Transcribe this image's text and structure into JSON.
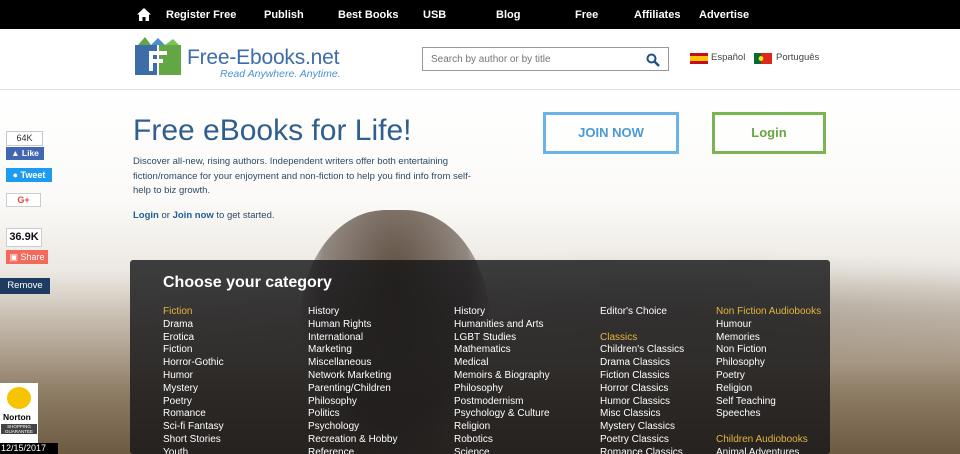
{
  "topnav": {
    "items": [
      "Register Free",
      "Publish",
      "Best Books",
      "USB",
      "Blog",
      "Free",
      "Affiliates",
      "Advertise"
    ]
  },
  "header": {
    "logo_name": "Free-Ebooks.net",
    "logo_tag": "Read Anywhere. Anytime.",
    "search_placeholder": "Search by author or by title",
    "lang_es": "Español",
    "lang_pt": "Português"
  },
  "hero": {
    "title": "Free eBooks for Life!",
    "description": "Discover all-new, rising authors. Independent writers offer both entertaining fiction/romance for your enjoyment and non-fiction to help you find info from self-help to biz growth.",
    "login_link": "Login",
    "or_text": " or ",
    "join_link": "Join now",
    "cta_suffix": " to get started.",
    "join_button": "JOIN NOW",
    "login_button": "Login"
  },
  "social": {
    "fb_count": "64K",
    "fb_like": "Like",
    "tweet": "Tweet",
    "gplus": "G+",
    "share_count": "36.9K",
    "share": "Share",
    "remove": "Remove"
  },
  "norton": {
    "name": "Norton",
    "label": "SHOPPING GUARANTEE",
    "date": "12/15/2017"
  },
  "categories": {
    "title": "Choose your category",
    "columns": [
      [
        {
          "t": "Fiction",
          "h": true
        },
        {
          "t": "Drama"
        },
        {
          "t": "Erotica"
        },
        {
          "t": "Fiction"
        },
        {
          "t": "Horror-Gothic"
        },
        {
          "t": "Humor"
        },
        {
          "t": "Mystery"
        },
        {
          "t": "Poetry"
        },
        {
          "t": "Romance"
        },
        {
          "t": "Sci-fi Fantasy"
        },
        {
          "t": "Short Stories"
        },
        {
          "t": "Youth"
        }
      ],
      [
        {
          "t": "History"
        },
        {
          "t": "Human Rights"
        },
        {
          "t": "International"
        },
        {
          "t": "Marketing"
        },
        {
          "t": "Miscellaneous"
        },
        {
          "t": "Network Marketing"
        },
        {
          "t": "Parenting/Children"
        },
        {
          "t": "Philosophy"
        },
        {
          "t": "Politics"
        },
        {
          "t": "Psychology"
        },
        {
          "t": "Recreation & Hobby"
        },
        {
          "t": "Reference"
        }
      ],
      [
        {
          "t": "History"
        },
        {
          "t": "Humanities and Arts"
        },
        {
          "t": "LGBT Studies"
        },
        {
          "t": "Mathematics"
        },
        {
          "t": "Medical"
        },
        {
          "t": "Memoirs & Biography"
        },
        {
          "t": "Philosophy"
        },
        {
          "t": "Postmodernism"
        },
        {
          "t": "Psychology & Culture"
        },
        {
          "t": "Religion"
        },
        {
          "t": "Robotics"
        },
        {
          "t": "Science"
        }
      ],
      [
        {
          "t": "Editor's Choice"
        },
        {
          "gap": true
        },
        {
          "t": "Classics",
          "h": true
        },
        {
          "t": "Children's Classics"
        },
        {
          "t": "Drama Classics"
        },
        {
          "t": "Fiction Classics"
        },
        {
          "t": "Horror Classics"
        },
        {
          "t": "Humor Classics"
        },
        {
          "t": "Misc Classics"
        },
        {
          "t": "Mystery Classics"
        },
        {
          "t": "Poetry Classics"
        },
        {
          "t": "Romance Classics"
        }
      ],
      [
        {
          "t": "Non Fiction Audiobooks",
          "h": true
        },
        {
          "t": "Humour"
        },
        {
          "t": "Memories"
        },
        {
          "t": "Non Fiction"
        },
        {
          "t": "Philosophy"
        },
        {
          "t": "Poetry"
        },
        {
          "t": "Religion"
        },
        {
          "t": "Self Teaching"
        },
        {
          "t": "Speeches"
        },
        {
          "gap": true
        },
        {
          "t": "Children Audiobooks",
          "h": true
        },
        {
          "t": "Animal Adventures"
        }
      ]
    ]
  },
  "colors": {
    "brand_blue": "#3d6da8",
    "join_blue": "#6ab3e8",
    "login_green": "#7ab553",
    "category_heading": "#e3b63e"
  }
}
